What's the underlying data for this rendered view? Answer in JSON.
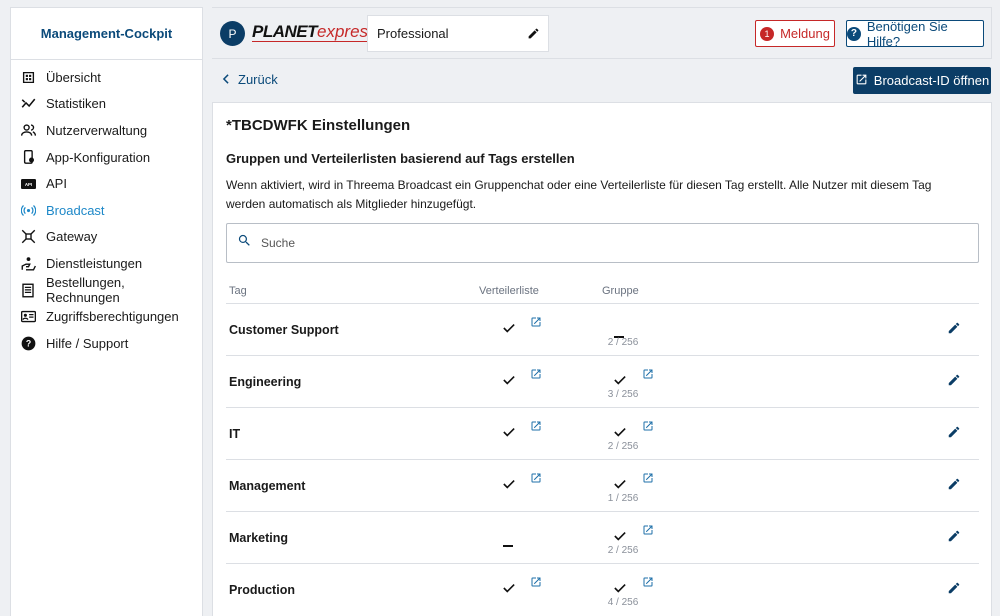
{
  "sidebar": {
    "title": "Management-Cockpit",
    "items": [
      {
        "label": "Übersicht",
        "icon": "dashboard-icon"
      },
      {
        "label": "Statistiken",
        "icon": "chart-line-icon"
      },
      {
        "label": "Nutzerverwaltung",
        "icon": "users-icon"
      },
      {
        "label": "App-Konfiguration",
        "icon": "app-config-icon"
      },
      {
        "label": "API",
        "icon": "api-icon"
      },
      {
        "label": "Broadcast",
        "icon": "broadcast-icon",
        "active": true
      },
      {
        "label": "Gateway",
        "icon": "gateway-icon"
      },
      {
        "label": "Dienstleistungen",
        "icon": "services-icon"
      },
      {
        "label": "Bestellungen, Rechnungen",
        "icon": "receipt-icon"
      },
      {
        "label": "Zugriffsberechtigungen",
        "icon": "id-card-icon"
      },
      {
        "label": "Hilfe / Support",
        "icon": "help-icon"
      }
    ]
  },
  "topbar": {
    "avatar_initial": "P",
    "logo_planet": "PLANET",
    "logo_express": "express",
    "tenant_value": "Professional",
    "meldung_count": "1",
    "meldung_label": "Meldung",
    "help_label": "Benötigen Sie Hilfe?"
  },
  "nav": {
    "back_label": "Zurück",
    "open_broadcast_label": "Broadcast-ID öffnen"
  },
  "panel": {
    "title": "*TBCDWFK Einstellungen",
    "section_title": "Gruppen und Verteilerlisten basierend auf Tags erstellen",
    "description": "Wenn aktiviert, wird in Threema Broadcast ein Gruppenchat oder eine Verteilerliste für diesen Tag erstellt. Alle Nutzer mit diesem Tag werden automatisch als Mitglieder hinzugefügt.",
    "search_placeholder": "Suche",
    "columns": {
      "tag": "Tag",
      "verteilerliste": "Verteilerliste",
      "gruppe": "Gruppe"
    },
    "rows": [
      {
        "tag": "Customer Support",
        "list": true,
        "group": false,
        "count": "2 / 256"
      },
      {
        "tag": "Engineering",
        "list": true,
        "group": true,
        "count": "3 / 256"
      },
      {
        "tag": "IT",
        "list": true,
        "group": true,
        "count": "2 / 256"
      },
      {
        "tag": "Management",
        "list": true,
        "group": true,
        "count": "1 / 256"
      },
      {
        "tag": "Marketing",
        "list": false,
        "group": true,
        "count": "2 / 256"
      },
      {
        "tag": "Production",
        "list": true,
        "group": true,
        "count": "4 / 256"
      }
    ]
  },
  "colors": {
    "brand": "#0b3d66",
    "link": "#0b4a7a",
    "active": "#1e88c8",
    "alert": "#c62828"
  }
}
